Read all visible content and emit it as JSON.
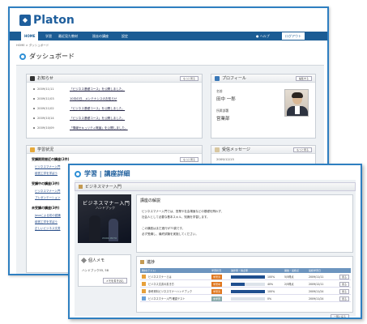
{
  "app": {
    "name": "Platon"
  },
  "nav": {
    "items": [
      "HOME",
      "学習",
      "最近見た教材",
      "過去の講座",
      "設定"
    ],
    "help": "ヘルプ",
    "logout": "ログアウト"
  },
  "breadcrumb": "HOME > ダッシュボード",
  "dashboard": {
    "title": "ダッシュボード",
    "news": {
      "title": "お知らせ",
      "more": "もっと見る",
      "items": [
        {
          "date": "2009/11/11",
          "text": "「ビジネス基礎コース」を公開しました。"
        },
        {
          "date": "2009/11/03",
          "text": "10月の日、メンテナンスのお知らせ"
        },
        {
          "date": "2009/11/02",
          "text": "「ビジネス基礎コース」を公開しました。"
        },
        {
          "date": "2009/10/14",
          "text": "「ビジネス基礎コース」を公開しました。"
        },
        {
          "date": "2009/10/09",
          "text": "「情報セキュリティ概論」を公開しました。"
        }
      ]
    },
    "profile": {
      "title": "プロフィール",
      "edit": "編集する",
      "name_label": "名前",
      "name": "田中 一郎",
      "dept_label": "所属部署",
      "dept": "営業部"
    },
    "study": {
      "title": "学習状況",
      "more": "もっと見る",
      "sections": [
        {
          "head": "受講期限間近の講座(2件)",
          "items": [
            "ビジネスマナー入門",
            "経営工学を学ぼう"
          ]
        },
        {
          "head": "受講中の講座(3件)",
          "items": [
            "ビジネスマナー入門",
            "プレゼンテーション"
          ]
        },
        {
          "head": "未受講の講座(3件)",
          "items": [
            "Javaによる初の認識",
            "経営工学を学ぼう",
            "正しいビジネス文書"
          ]
        }
      ]
    },
    "inbox": {
      "title": "受信メッセージ",
      "more": "もっと見る",
      "date": "2009/12/15",
      "text": "Re: Re: Re: への質問について"
    }
  },
  "detail": {
    "title": "学習 | 講座詳細",
    "course": "ビジネスマナー入門",
    "cover": {
      "title": "ビジネスマナー入門",
      "subtitle": "ハンドブック",
      "publisher": "WORK MOTO"
    },
    "memo": {
      "title": "個人メモ",
      "text": "ハンドブック55, 58",
      "button": "メモを書き込む"
    },
    "explain": {
      "title": "講座の解説",
      "lines": [
        "ビジネスマナー入門では、営業や社会場面などの基礎を問わず、",
        "社会人として必要な基本スキル、知識を学習します。",
        "",
        "この講座はまだ進行が73頁です。",
        "必ず受講し、最終試験を実施してください。"
      ]
    },
    "progress": {
      "title": "進捗",
      "columns": [
        "教材(テスト)",
        "学習状況",
        "進捗率・得点率",
        "開始・最終点",
        "最終学習日"
      ],
      "rows": [
        {
          "name": "ビジネスマナーとは",
          "status": "学習済",
          "pct": "100%",
          "score": "5/5得点",
          "date": "2009/11/11",
          "fill": 1.0
        },
        {
          "name": "ビジネス文書の書き方",
          "status": "学習中",
          "pct": "40%",
          "score": "2/5得点",
          "date": "2009/12/11",
          "fill": 0.4
        },
        {
          "name": "参考資料ビジネスマナーハンドブック",
          "status": "学習済",
          "pct": "100%",
          "score": "",
          "date": "2009/11/24",
          "fill": 1.0
        },
        {
          "name": "ビジネスマナー入門 確認テスト",
          "status": "未学習",
          "pct": "0%",
          "score": "",
          "date": "2009/11/24",
          "fill": 0.0
        }
      ],
      "row_button": "見る",
      "list_all": "一覧に戻る"
    }
  },
  "colors": {
    "brand": "#1f5f9d",
    "nav": "#1b5c94",
    "accent": "#e0771e",
    "bar": "#1f4f8f"
  }
}
